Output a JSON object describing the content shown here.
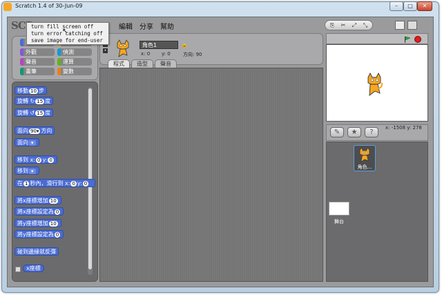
{
  "window": {
    "title": "Scratch 1.4 of 30-Jun-09",
    "min": "–",
    "max": "□",
    "close": "✕"
  },
  "logo": "SCR",
  "menu": {
    "edit": "編輯",
    "share": "分享",
    "help": "幫助"
  },
  "file_menu": [
    "turn fill screen off",
    "turn error catching off",
    "save image for end-user"
  ],
  "categories": [
    {
      "label": "動作",
      "color": "#4a6cd4"
    },
    {
      "label": "控制",
      "color": "#e6a822"
    },
    {
      "label": "外觀",
      "color": "#8a55d7"
    },
    {
      "label": "偵測",
      "color": "#0e9bd8"
    },
    {
      "label": "聲音",
      "color": "#bb42c3"
    },
    {
      "label": "運算",
      "color": "#5cb712"
    },
    {
      "label": "畫筆",
      "color": "#0e9a6c"
    },
    {
      "label": "變數",
      "color": "#ee7d16"
    }
  ],
  "blocks": {
    "move": {
      "pre": "移動",
      "v": "10",
      "post": "步"
    },
    "turn_cw": {
      "pre": "旋轉 ↻",
      "v": "15",
      "post": "度"
    },
    "turn_ccw": {
      "pre": "旋轉 ↺",
      "v": "15",
      "post": "度"
    },
    "point_dir": {
      "pre": "面向",
      "v": "90▾",
      "post": "方向"
    },
    "point_towards": {
      "pre": "面向",
      "v": "▾"
    },
    "goto_xy": {
      "pre": "移到 x:",
      "v1": "0",
      "mid": "y:",
      "v2": "0"
    },
    "goto": {
      "pre": "移到",
      "v": "▾"
    },
    "glide": {
      "pre": "在",
      "v1": "1",
      "mid1": "秒內，滑行到 x:",
      "v2": "0",
      "mid2": "y:",
      "v3": "0"
    },
    "change_x": {
      "pre": "將x座標增加",
      "v": "10"
    },
    "set_x": {
      "pre": "將x座標設定為",
      "v": "0"
    },
    "change_y": {
      "pre": "將y座標增加",
      "v": "10"
    },
    "set_y": {
      "pre": "將y座標設定為",
      "v": "0"
    },
    "bounce": {
      "pre": "碰到邊緣就反彈"
    },
    "x_reporter": {
      "pre": "x座標"
    }
  },
  "sprite": {
    "name": "角色1",
    "x_label": "x: 0",
    "y_label": "y: 0",
    "dir_label": "方向: 90"
  },
  "tabs": [
    "程式",
    "造型",
    "聲音"
  ],
  "stage": {
    "xy": "x: -1508  y: 278"
  },
  "library": {
    "sprite_label": "角色...",
    "stage_label": "舞台"
  }
}
